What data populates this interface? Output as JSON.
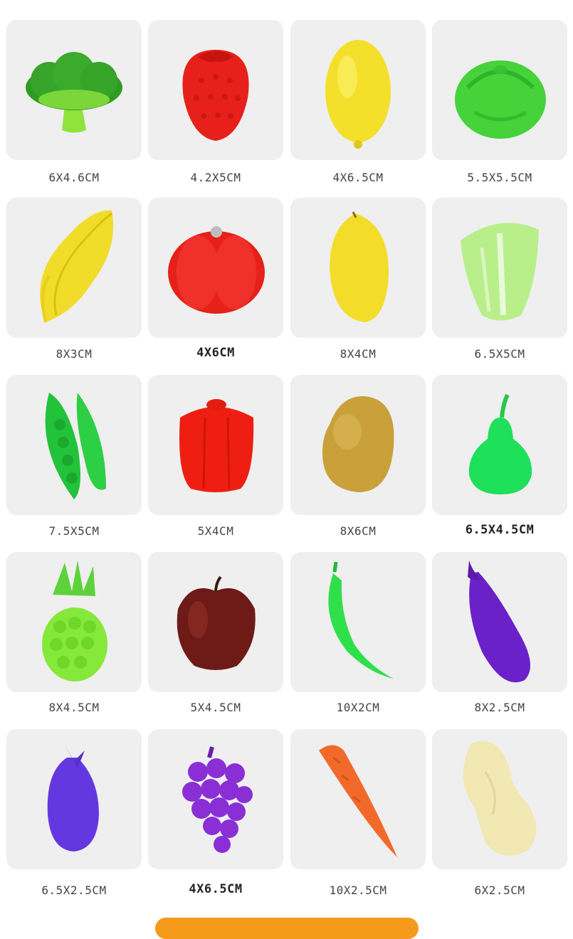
{
  "items": [
    {
      "name": "broccoli",
      "size": "6X4.6CM",
      "bold": false
    },
    {
      "name": "strawberry",
      "size": "4.2X5CM",
      "bold": false
    },
    {
      "name": "lemon",
      "size": "4X6.5CM",
      "bold": false
    },
    {
      "name": "cabbage",
      "size": "5.5X5.5CM",
      "bold": false
    },
    {
      "name": "corn",
      "size": "8X3CM",
      "bold": false
    },
    {
      "name": "tomato",
      "size": "4X6CM",
      "bold": true
    },
    {
      "name": "mango",
      "size": "8X4CM",
      "bold": false
    },
    {
      "name": "chinese-cabbage",
      "size": "6.5X5CM",
      "bold": false
    },
    {
      "name": "peas",
      "size": "7.5X5CM",
      "bold": false
    },
    {
      "name": "bell-pepper",
      "size": "5X4CM",
      "bold": false
    },
    {
      "name": "potato",
      "size": "8X6CM",
      "bold": false
    },
    {
      "name": "pear",
      "size": "6.5X4.5CM",
      "bold": true
    },
    {
      "name": "pineapple",
      "size": "8X4.5CM",
      "bold": false
    },
    {
      "name": "apple",
      "size": "5X4.5CM",
      "bold": false
    },
    {
      "name": "chili",
      "size": "10X2CM",
      "bold": false
    },
    {
      "name": "eggplant",
      "size": "8X2.5CM",
      "bold": false
    },
    {
      "name": "short-eggplant",
      "size": "6.5X2.5CM",
      "bold": false
    },
    {
      "name": "grapes",
      "size": "4X6.5CM",
      "bold": true
    },
    {
      "name": "carrot",
      "size": "10X2.5CM",
      "bold": false
    },
    {
      "name": "peanut",
      "size": "6X2.5CM",
      "bold": false
    }
  ]
}
